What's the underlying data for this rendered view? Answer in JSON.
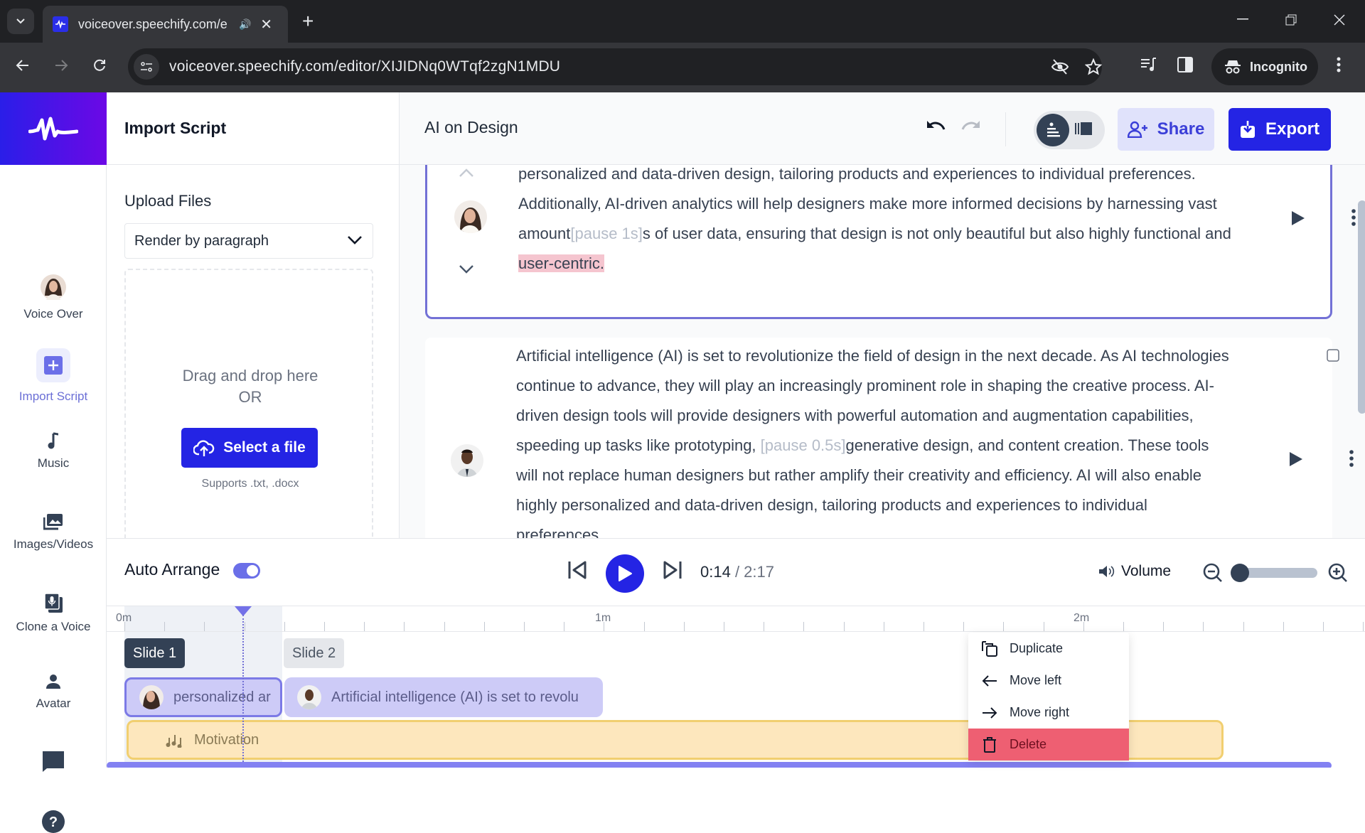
{
  "browser": {
    "tab_title": "voiceover.speechify.com/e",
    "url": "voiceover.speechify.com/editor/XIJIDNq0WTqf2zgN1MDU",
    "profile_label": "Incognito"
  },
  "brand": {
    "primary": "#2424e4",
    "accent": "#7371d6",
    "logo_gradient": [
      "#2a1ee8",
      "#6c08e6"
    ]
  },
  "sidebar": {
    "items": [
      {
        "label": "Voice Over",
        "icon": "voice-avatar"
      },
      {
        "label": "Import Script",
        "icon": "plus-square-icon",
        "active": true
      },
      {
        "label": "Music",
        "icon": "music-note-icon"
      },
      {
        "label": "Images/Videos",
        "icon": "images-icon"
      },
      {
        "label": "Clone a Voice",
        "icon": "mic-stack-icon"
      },
      {
        "label": "Avatar",
        "icon": "person-icon"
      },
      {
        "label": "",
        "icon": "chat-icon"
      },
      {
        "label": "",
        "icon": "help-icon"
      }
    ]
  },
  "import_panel": {
    "title": "Import Script",
    "upload_title": "Upload Files",
    "render_mode": "Render by paragraph",
    "drop_text": "Drag and drop here",
    "or_text": "OR",
    "select_button": "Select a file",
    "supports": "Supports .txt, .docx"
  },
  "editor": {
    "project_title": "AI on Design",
    "share_label": "Share",
    "export_label": "Export",
    "blocks": [
      {
        "selected": true,
        "voice": "female",
        "segments": [
          {
            "t": "personalized and data-driven design, tailoring products and experiences to individual preferences. Additionally, AI-driven analytics will help designers make more informed decisions by harnessing vast amount"
          },
          {
            "t": "[pause 1s]",
            "kind": "pause"
          },
          {
            "t": "s of user data, ensuring that design is not only beautiful but also highly functional and "
          },
          {
            "t": "user-centric.",
            "kind": "highlight"
          }
        ]
      },
      {
        "selected": false,
        "voice": "male",
        "segments": [
          {
            "t": "Artificial intelligence (AI) is set to revolutionize the field of design in the next decade. As AI technologies continue to advance, they will play an increasingly prominent role in shaping the creative process. AI-driven design tools will provide designers with powerful automation and augmentation capabilities, speeding up tasks like prototyping, "
          },
          {
            "t": "[pause 0.5s]",
            "kind": "pause"
          },
          {
            "t": "generative design, and content creation. These tools will not replace human designers but rather amplify their creativity and efficiency. AI will also enable highly personalized and data-driven design, tailoring products and experiences to individual preferences."
          }
        ]
      }
    ]
  },
  "player": {
    "auto_arrange_label": "Auto Arrange",
    "auto_arrange_on": true,
    "current_time": "0:14",
    "separator": " / ",
    "total_time": "2:17",
    "volume_label": "Volume",
    "zoom_level": 0.0
  },
  "timeline": {
    "ruler_labels": [
      "0m",
      "1m",
      "2m"
    ],
    "playhead_seconds": 14,
    "slides": [
      {
        "label": "Slide 1",
        "clip_text": "personalized ar"
      },
      {
        "label": "Slide 2",
        "clip_text": "Artificial intelligence (AI) is set to revolu"
      }
    ],
    "music_label": "Motivation"
  },
  "context_menu": {
    "items": [
      {
        "label": "Duplicate",
        "icon": "duplicate-icon"
      },
      {
        "label": "Move left",
        "icon": "arrow-left-icon"
      },
      {
        "label": "Move right",
        "icon": "arrow-right-icon"
      },
      {
        "label": "Delete",
        "icon": "trash-icon",
        "hovered": true
      }
    ]
  }
}
